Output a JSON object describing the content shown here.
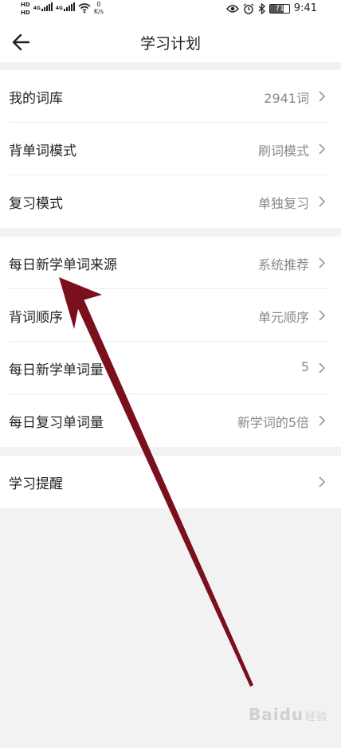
{
  "status_bar": {
    "hd1": "HD",
    "hd2": "HD",
    "net1": "4G",
    "net2": "4G",
    "speed_value": "0",
    "speed_unit": "K/s",
    "battery": "71",
    "time": "9:41"
  },
  "header": {
    "title": "学习计划"
  },
  "settings": {
    "group1": [
      {
        "label": "我的词库",
        "value": "2941词"
      },
      {
        "label": "背单词模式",
        "value": "刷词模式"
      },
      {
        "label": "复习模式",
        "value": "单独复习"
      }
    ],
    "group2": [
      {
        "label": "每日新学单词来源",
        "value": "系统推荐"
      },
      {
        "label": "背词顺序",
        "value": "单元顺序"
      },
      {
        "label": "每日新学单词量",
        "value": "5"
      },
      {
        "label": "每日复习单词量",
        "value": "新学词的5倍"
      }
    ],
    "group3": [
      {
        "label": "学习提醒",
        "value": ""
      }
    ]
  },
  "annotation": {
    "color": "#7a0f1e"
  },
  "watermark": {
    "text": "Baidu",
    "sub": "经验"
  }
}
